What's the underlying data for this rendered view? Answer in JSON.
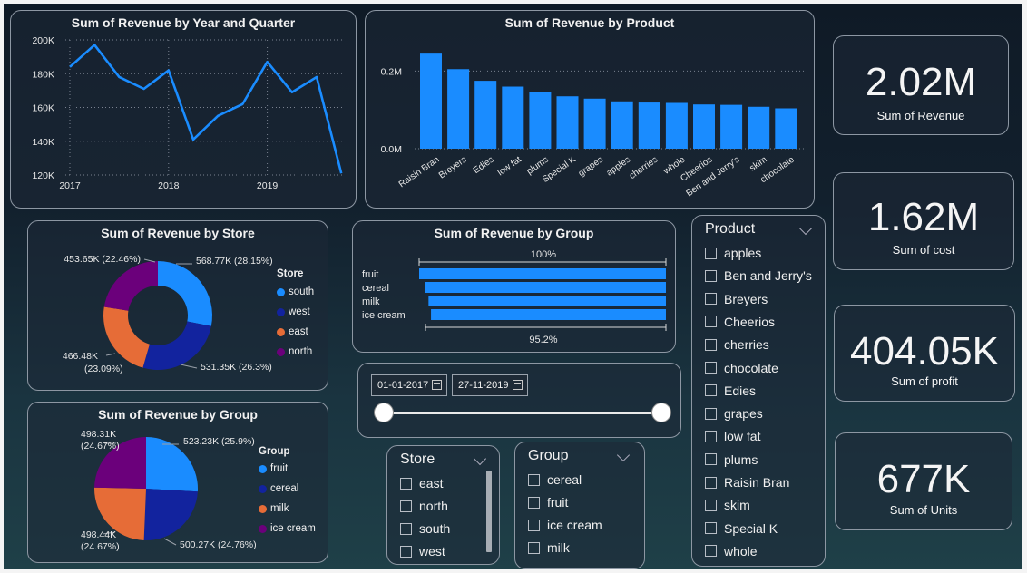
{
  "colors": {
    "blue": "#1a8cff",
    "navy": "#12239e",
    "orange": "#e66c37",
    "purple": "#6b007b",
    "line": "#1a8cff"
  },
  "charts": {
    "year_quarter": {
      "title": "Sum of Revenue by Year and Quarter"
    },
    "product": {
      "title": "Sum of Revenue by Product"
    },
    "store": {
      "title": "Sum of Revenue by Store"
    },
    "group_bar": {
      "title": "Sum of Revenue by Group"
    },
    "group_pie": {
      "title": "Sum of Revenue by Group"
    }
  },
  "chart_data": [
    {
      "type": "line",
      "title": "Sum of Revenue by Year and Quarter",
      "x": [
        "2017 Q1",
        "2017 Q2",
        "2017 Q3",
        "2017 Q4",
        "2018 Q1",
        "2018 Q2",
        "2018 Q3",
        "2018 Q4",
        "2019 Q1",
        "2019 Q2",
        "2019 Q3",
        "2019 Q4"
      ],
      "values": [
        184000,
        197000,
        178000,
        171000,
        182000,
        141000,
        155000,
        162000,
        187000,
        169000,
        178000,
        121000
      ],
      "x_tick_labels": [
        "2017",
        "2018",
        "2019"
      ],
      "y_tick_labels": [
        "120K",
        "140K",
        "160K",
        "180K",
        "200K"
      ],
      "ylim": [
        120000,
        200000
      ],
      "grid": true
    },
    {
      "type": "bar",
      "title": "Sum of Revenue by Product",
      "categories": [
        "Raisin Bran",
        "Breyers",
        "Edies",
        "low fat",
        "plums",
        "Special K",
        "grapes",
        "apples",
        "cherries",
        "whole",
        "Cheerios",
        "Ben and Jerry's",
        "skim",
        "chocolate"
      ],
      "values": [
        0.245,
        0.205,
        0.175,
        0.16,
        0.147,
        0.135,
        0.129,
        0.122,
        0.119,
        0.118,
        0.114,
        0.113,
        0.108,
        0.104
      ],
      "y_tick_labels": [
        "0.0M",
        "0.2M"
      ],
      "ylim": [
        0,
        0.25
      ]
    },
    {
      "type": "pie",
      "title": "Sum of Revenue by Store",
      "donut": true,
      "legend_title": "Store",
      "categories": [
        "south",
        "west",
        "east",
        "north"
      ],
      "values": [
        568770,
        531350,
        466480,
        453650
      ],
      "data_labels": [
        "568.77K (28.15%)",
        "531.35K (26.3%)",
        "466.48K (23.09%)",
        "453.65K (22.46%)"
      ]
    },
    {
      "type": "bar",
      "title": "Sum of Revenue by Group",
      "orientation": "horizontal",
      "categories": [
        "fruit",
        "cereal",
        "milk",
        "ice cream"
      ],
      "values": [
        100,
        97.5,
        96.2,
        95.2
      ],
      "top_label": "100%",
      "bottom_label": "95.2%"
    },
    {
      "type": "pie",
      "title": "Sum of Revenue by Group",
      "legend_title": "Group",
      "categories": [
        "fruit",
        "cereal",
        "milk",
        "ice cream"
      ],
      "values": [
        523230,
        500270,
        498440,
        498310
      ],
      "data_labels": [
        "523.23K (25.9%)",
        "500.27K (24.76%)",
        "498.44K (24.67%)",
        "498.31K (24.67%)"
      ]
    }
  ],
  "kpis": [
    {
      "value": "2.02M",
      "label": "Sum of Revenue"
    },
    {
      "value": "1.62M",
      "label": "Sum of cost"
    },
    {
      "value": "404.05K",
      "label": "Sum of profit"
    },
    {
      "value": "677K",
      "label": "Sum of Units"
    }
  ],
  "date_slicer": {
    "start": "01-01-2017",
    "end": "27-11-2019",
    "range_fraction": [
      0,
      1
    ]
  },
  "slicers": {
    "product": {
      "title": "Product",
      "items": [
        "apples",
        "Ben and Jerry's",
        "Breyers",
        "Cheerios",
        "cherries",
        "chocolate",
        "Edies",
        "grapes",
        "low fat",
        "plums",
        "Raisin Bran",
        "skim",
        "Special K",
        "whole"
      ]
    },
    "store": {
      "title": "Store",
      "items": [
        "east",
        "north",
        "south",
        "west"
      ]
    },
    "group": {
      "title": "Group",
      "items": [
        "cereal",
        "fruit",
        "ice cream",
        "milk"
      ]
    }
  }
}
